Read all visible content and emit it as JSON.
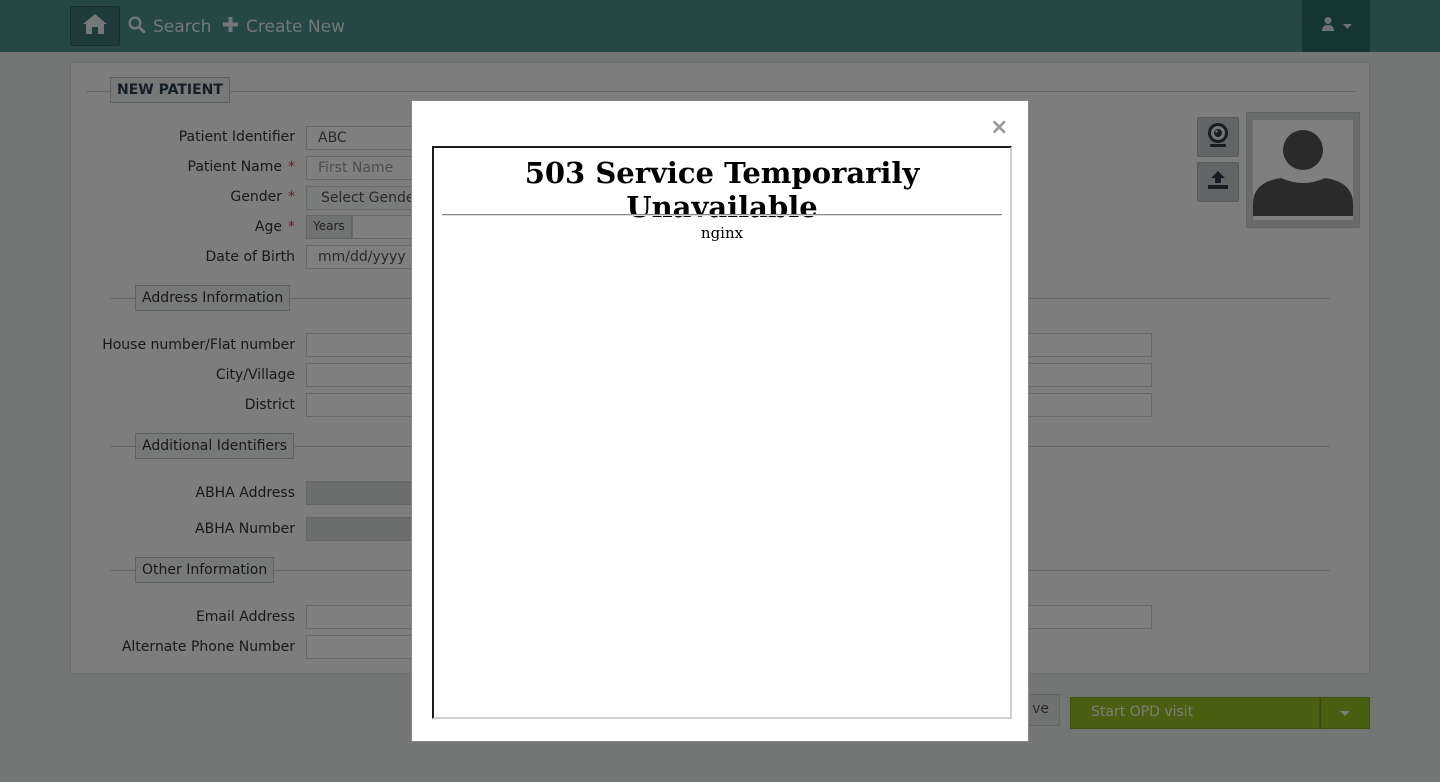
{
  "nav": {
    "search_label": "Search",
    "create_label": "Create New",
    "icons": {
      "home": "home-icon",
      "search": "search-icon",
      "create": "plus-icon",
      "user": "user-icon"
    }
  },
  "form": {
    "section_title": "NEW PATIENT",
    "fields": {
      "patient_identifier": {
        "label": "Patient Identifier",
        "value": "ABC"
      },
      "patient_name": {
        "label": "Patient Name",
        "placeholder": "First Name",
        "required": "*"
      },
      "gender": {
        "label": "Gender",
        "value": "Select Gender",
        "required": "*"
      },
      "age": {
        "label": "Age",
        "unit": "Years",
        "required": "*"
      },
      "dob": {
        "label": "Date of Birth",
        "placeholder": "mm/dd/yyyy"
      }
    },
    "address": {
      "title": "Address Information",
      "house_label": "House number/Flat number",
      "city_label": "City/Village",
      "district_label": "District"
    },
    "identifiers": {
      "title": "Additional Identifiers",
      "abha_address_label": "ABHA Address",
      "abha_number_label": "ABHA Number"
    },
    "other": {
      "title": "Other Information",
      "email_label": "Email Address",
      "alt_phone_label": "Alternate Phone Number"
    }
  },
  "actions": {
    "save_label": "ve",
    "start_opd_label": "Start OPD visit"
  },
  "modal": {
    "close_glyph": "×",
    "error_title": "503 Service Temporarily Unavailable",
    "server_name": "nginx"
  },
  "colors": {
    "topbar": "#4a8e8a",
    "user_menu": "#2c6b64",
    "opd_button": "#93c125",
    "required": "#d43a3a"
  }
}
